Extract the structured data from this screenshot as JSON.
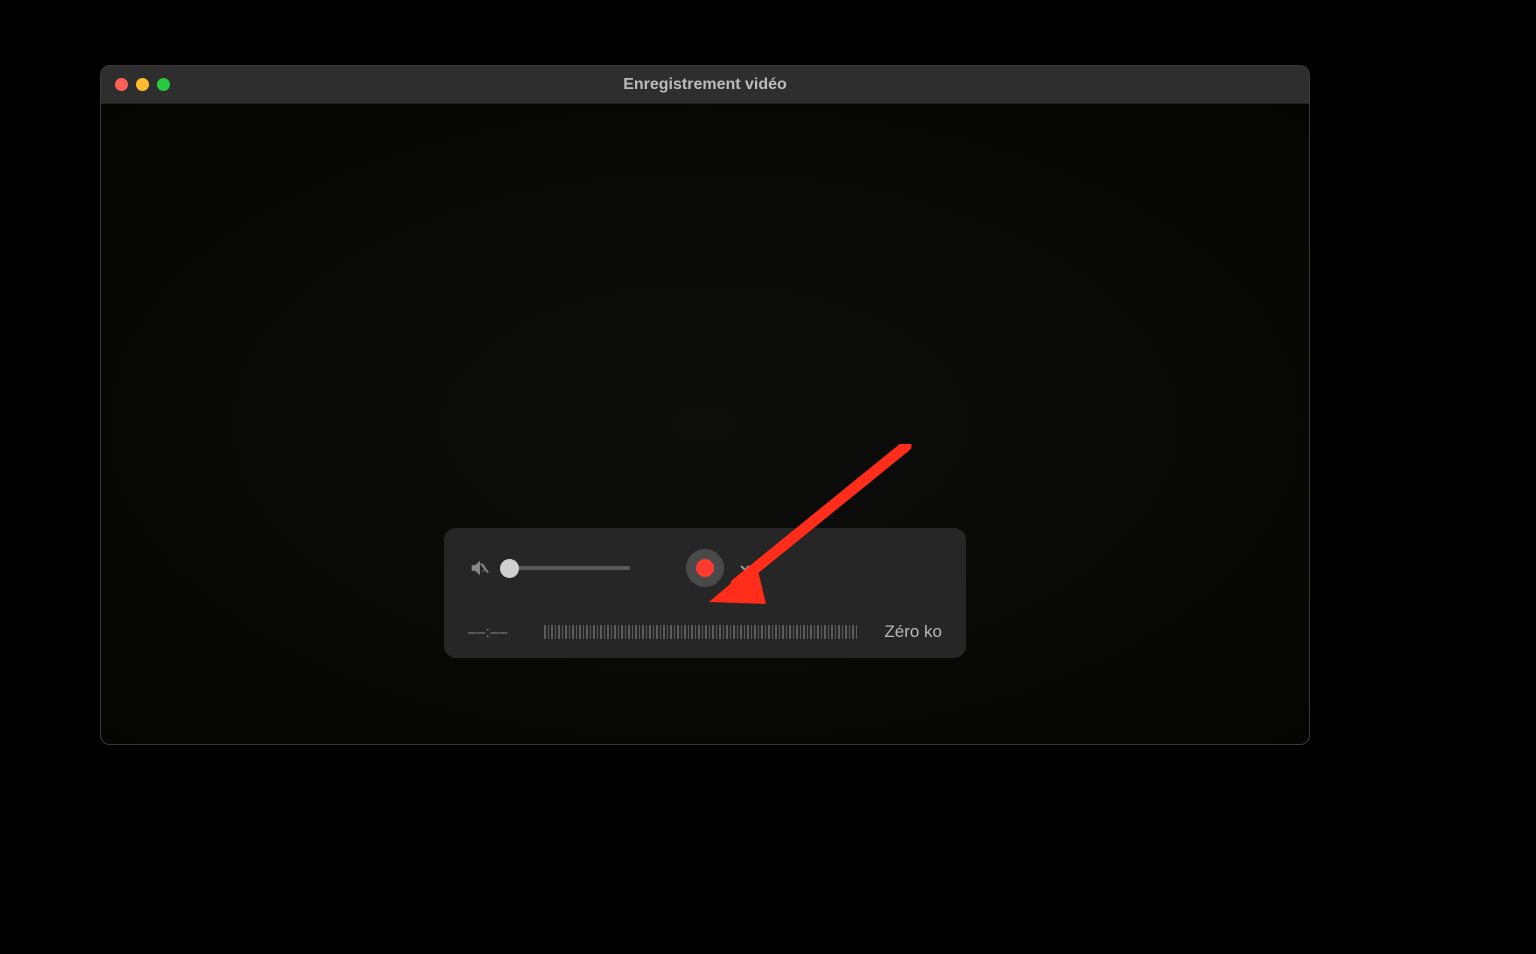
{
  "window": {
    "title": "Enregistrement vidéo"
  },
  "controls": {
    "timecode": "––:––",
    "filesize": "Zéro ko",
    "volume_value": 0
  },
  "icons": {
    "mute": "volume-muted-icon",
    "record": "record-icon",
    "chevron": "chevron-down-icon",
    "close": "close-icon",
    "minimize": "minimize-icon",
    "maximize": "maximize-icon"
  },
  "colors": {
    "record_red": "#ff3b30",
    "arrow_red": "#ff2d1a",
    "panel_bg": "#282828"
  },
  "annotation": {
    "arrow_target": "record-button"
  }
}
